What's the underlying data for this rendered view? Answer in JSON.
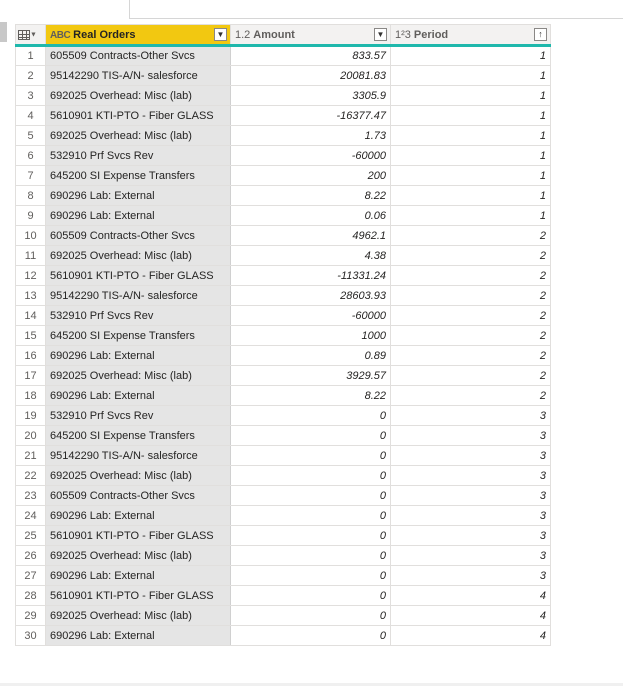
{
  "columns": [
    {
      "type_icon": "ABC",
      "label": "Real Orders",
      "filter_icon": "chevron-down-icon"
    },
    {
      "type_icon": "1.2",
      "label": "Amount",
      "filter_icon": "chevron-down-icon"
    },
    {
      "type_icon": "1²3",
      "label": "Period",
      "filter_icon": "sort-ascending-icon"
    }
  ],
  "corner": {
    "icon": "table-icon",
    "caret_icon": "chevron-down-icon"
  },
  "rows": [
    {
      "num": "1",
      "order": "605509  Contracts-Other Svcs",
      "amount": "833.57",
      "period": "1"
    },
    {
      "num": "2",
      "order": "95142290  TIS-A/N-  salesforce",
      "amount": "20081.83",
      "period": "1"
    },
    {
      "num": "3",
      "order": "692025  Overhead: Misc (lab)",
      "amount": "3305.9",
      "period": "1"
    },
    {
      "num": "4",
      "order": "5610901  KTI-PTO - Fiber GLASS",
      "amount": "-16377.47",
      "period": "1"
    },
    {
      "num": "5",
      "order": "692025  Overhead: Misc (lab)",
      "amount": "1.73",
      "period": "1"
    },
    {
      "num": "6",
      "order": "532910  Prf Svcs Rev",
      "amount": "-60000",
      "period": "1"
    },
    {
      "num": "7",
      "order": "645200  SI Expense Transfers",
      "amount": "200",
      "period": "1"
    },
    {
      "num": "8",
      "order": "690296  Lab: External",
      "amount": "8.22",
      "period": "1"
    },
    {
      "num": "9",
      "order": "690296  Lab: External",
      "amount": "0.06",
      "period": "1"
    },
    {
      "num": "10",
      "order": "605509  Contracts-Other Svcs",
      "amount": "4962.1",
      "period": "2"
    },
    {
      "num": "11",
      "order": "692025  Overhead: Misc (lab)",
      "amount": "4.38",
      "period": "2"
    },
    {
      "num": "12",
      "order": "5610901  KTI-PTO - Fiber GLASS",
      "amount": "-11331.24",
      "period": "2"
    },
    {
      "num": "13",
      "order": "95142290  TIS-A/N-  salesforce",
      "amount": "28603.93",
      "period": "2"
    },
    {
      "num": "14",
      "order": "532910  Prf Svcs Rev",
      "amount": "-60000",
      "period": "2"
    },
    {
      "num": "15",
      "order": "645200  SI Expense Transfers",
      "amount": "1000",
      "period": "2"
    },
    {
      "num": "16",
      "order": "690296  Lab: External",
      "amount": "0.89",
      "period": "2"
    },
    {
      "num": "17",
      "order": "692025  Overhead: Misc (lab)",
      "amount": "3929.57",
      "period": "2"
    },
    {
      "num": "18",
      "order": "690296  Lab: External",
      "amount": "8.22",
      "period": "2"
    },
    {
      "num": "19",
      "order": "532910  Prf Svcs Rev",
      "amount": "0",
      "period": "3"
    },
    {
      "num": "20",
      "order": "645200  SI Expense Transfers",
      "amount": "0",
      "period": "3"
    },
    {
      "num": "21",
      "order": "95142290  TIS-A/N-  salesforce",
      "amount": "0",
      "period": "3"
    },
    {
      "num": "22",
      "order": "692025  Overhead: Misc (lab)",
      "amount": "0",
      "period": "3"
    },
    {
      "num": "23",
      "order": "605509  Contracts-Other Svcs",
      "amount": "0",
      "period": "3"
    },
    {
      "num": "24",
      "order": "690296  Lab: External",
      "amount": "0",
      "period": "3"
    },
    {
      "num": "25",
      "order": "5610901  KTI-PTO - Fiber GLASS",
      "amount": "0",
      "period": "3"
    },
    {
      "num": "26",
      "order": "692025  Overhead: Misc (lab)",
      "amount": "0",
      "period": "3"
    },
    {
      "num": "27",
      "order": "690296  Lab: External",
      "amount": "0",
      "period": "3"
    },
    {
      "num": "28",
      "order": "5610901  KTI-PTO - Fiber GLASS",
      "amount": "0",
      "period": "4"
    },
    {
      "num": "29",
      "order": "692025  Overhead: Misc (lab)",
      "amount": "0",
      "period": "4"
    },
    {
      "num": "30",
      "order": "690296  Lab: External",
      "amount": "0",
      "period": "4"
    }
  ],
  "colors": {
    "selected_header": "#f2c811",
    "header_underline": "#1fb8ac",
    "text_column_bg": "#e5e5e5"
  }
}
